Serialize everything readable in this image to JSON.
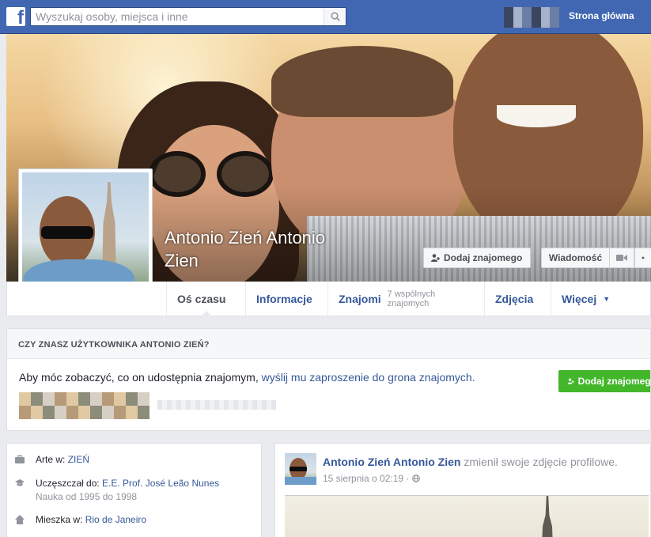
{
  "topbar": {
    "logo": "f",
    "search_placeholder": "Wyszukaj osoby, miejsca i inne",
    "home_label": "Strona główna"
  },
  "profile": {
    "name": "Antonio Zień Antonio Zien"
  },
  "cover_actions": {
    "add_friend": "Dodaj znajomego",
    "message": "Wiadomość"
  },
  "nav": {
    "timeline": "Oś czasu",
    "about": "Informacje",
    "friends": "Znajomi",
    "friends_sub": "7 wspólnych znajomych",
    "photos": "Zdjęcia",
    "more": "Więcej"
  },
  "know_box": {
    "heading": "CZY ZNASZ UŻYTKOWNIKA ANTONIO ZIEŃ?",
    "text_before": "Aby móc zobaczyć, co on udostępnia znajomym, ",
    "link": "wyślij mu zaproszenie do grona znajomych.",
    "add_button": "Dodaj znajomego"
  },
  "intro": {
    "work_label": "Arte w:",
    "work_value": "ZIEŃ",
    "edu_label": "Uczęszczał do:",
    "edu_value": "E.E. Prof. José Leão Nunes",
    "edu_years": "Nauka od 1995 do 1998",
    "home_label": "Mieszka w:",
    "home_value": "Rio de Janeiro"
  },
  "post": {
    "author": "Antonio Zień Antonio Zien",
    "action": "zmienił swoje zdjęcie profilowe.",
    "date": "15 sierpnia o 02:19 ·"
  },
  "colors": {
    "brand": "#4267b2",
    "link": "#365899",
    "green": "#42b72a"
  }
}
